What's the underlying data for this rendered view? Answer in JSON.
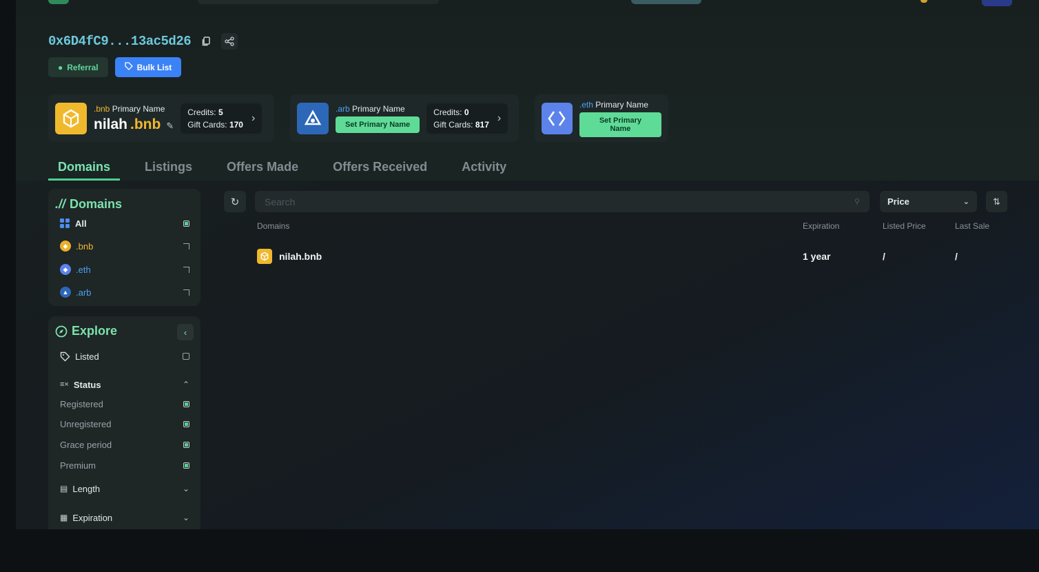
{
  "header": {
    "address": "0x6D4fC9...13ac5d26",
    "referral_label": "Referral",
    "bulk_list_label": "Bulk List"
  },
  "primary_names": [
    {
      "tld": ".bnb",
      "title_suffix": "Primary Name",
      "name": "nilah",
      "name_tld": ".bnb",
      "credits_label": "Credits:",
      "credits": "5",
      "gift_label": "Gift Cards:",
      "gift_cards": "170"
    },
    {
      "tld": ".arb",
      "title_suffix": "Primary Name",
      "set_label": "Set Primary Name",
      "credits_label": "Credits:",
      "credits": "0",
      "gift_label": "Gift Cards:",
      "gift_cards": "817"
    },
    {
      "tld": ".eth",
      "title_suffix": "Primary Name",
      "set_label": "Set Primary Name"
    }
  ],
  "tabs": [
    "Domains",
    "Listings",
    "Offers Made",
    "Offers Received",
    "Activity"
  ],
  "sidebar": {
    "domains_title": "Domains",
    "domain_filters": [
      "All",
      ".bnb",
      ".eth",
      ".arb"
    ],
    "explore_title": "Explore",
    "listed_label": "Listed",
    "status_label": "Status",
    "status_options": [
      "Registered",
      "Unregistered",
      "Grace period",
      "Premium"
    ],
    "length_label": "Length",
    "expiration_label": "Expiration"
  },
  "toolbar": {
    "search_placeholder": "Search",
    "sort_value": "Price"
  },
  "table": {
    "columns": [
      "Domains",
      "Expiration",
      "Listed Price",
      "Last Sale"
    ],
    "rows": [
      {
        "domain": "nilah.bnb",
        "expiration": "1 year",
        "listed_price": "/",
        "last_sale": "/"
      }
    ]
  },
  "colors": {
    "accent_green": "#4fcf8f",
    "address_cyan": "#6cc8dc",
    "bnb_gold": "#f0b92d",
    "bulk_blue": "#3b82f6"
  }
}
